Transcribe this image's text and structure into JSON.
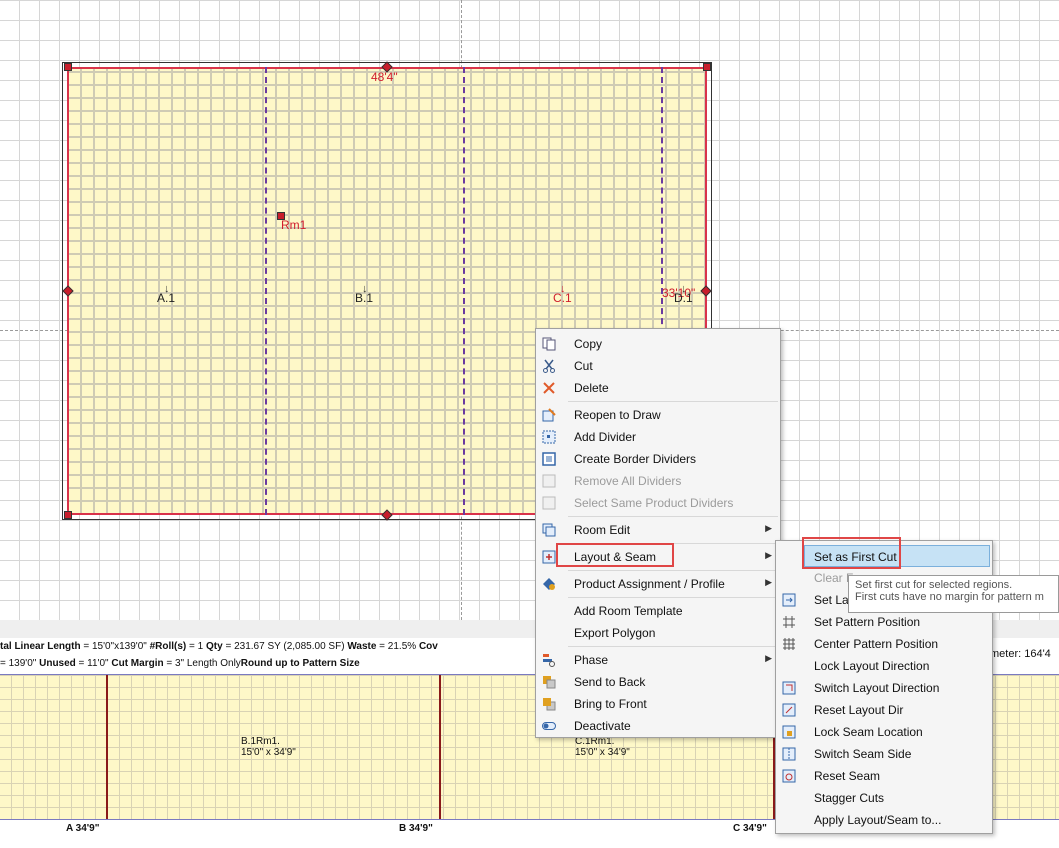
{
  "room": {
    "name": "Rm1",
    "top_dimension": "48'4\"",
    "right_dimension": "33'10\"",
    "regions": [
      {
        "label": "A.1",
        "color": "#222222"
      },
      {
        "label": "B.1",
        "color": "#222222"
      },
      {
        "label": "C.1",
        "color": "#d01c2c"
      },
      {
        "label": "D.1",
        "color": "#222222"
      }
    ]
  },
  "status": {
    "line1_prefix": "tal Linear Length",
    "line1_value": " = 15'0\"x139'0\"  ",
    "rolls_label": "#Roll(s)",
    "rolls_value": " = 1  ",
    "qty_label": "Qty",
    "qty_value": " = 231.67 SY (2,085.00 SF)  ",
    "waste_label": "Waste",
    "waste_value": " = 21.5%  ",
    "cov_label": "Cov",
    "line2_prefix": " = 139'0\"  ",
    "unused_label": "Unused",
    "unused_value": " = 11'0\" ",
    "cut_margin_label": "Cut Margin",
    "cut_margin_value": " = 3\" Length Only",
    "round_label": "Round up to Pattern Size",
    "perimeter_fragment": "meter: 164'4"
  },
  "strip": {
    "pieces": [
      {
        "name": "B.1Rm1.",
        "size": "15'0\" x 34'9\""
      },
      {
        "name": "C.1Rm1.",
        "size": "15'0\" x 34'9\""
      }
    ],
    "axis_labels": [
      "A 34'9\"",
      "B 34'9\"",
      "C 34'9\""
    ]
  },
  "context_menu": {
    "items": [
      {
        "label": "Copy",
        "icon": "copy-icon",
        "disabled": false
      },
      {
        "label": "Cut",
        "icon": "scissors-icon",
        "disabled": false
      },
      {
        "label": "Delete",
        "icon": "delete-x-icon",
        "disabled": false
      },
      {
        "label": "Reopen to Draw",
        "icon": "reopen-draw-icon",
        "disabled": false
      },
      {
        "label": "Add Divider",
        "icon": "add-divider-icon",
        "disabled": false
      },
      {
        "label": "Create Border Dividers",
        "icon": "border-dividers-icon",
        "disabled": false
      },
      {
        "label": "Remove All Dividers",
        "icon": "remove-dividers-icon",
        "disabled": true
      },
      {
        "label": "Select Same Product Dividers",
        "icon": "select-dividers-icon",
        "disabled": true
      },
      {
        "label": "Room Edit",
        "icon": "room-edit-icon",
        "disabled": false,
        "submenu": true
      },
      {
        "label": "Layout & Seam",
        "icon": "layout-seam-icon",
        "disabled": false,
        "submenu": true
      },
      {
        "label": "Product Assignment / Profile",
        "icon": "product-assignment-icon",
        "disabled": false,
        "submenu": true
      },
      {
        "label": "Add Room Template",
        "icon": "",
        "disabled": false
      },
      {
        "label": "Export Polygon",
        "icon": "",
        "disabled": false
      },
      {
        "label": "Phase",
        "icon": "phase-icon",
        "disabled": false,
        "submenu": true
      },
      {
        "label": "Send to Back",
        "icon": "send-to-back-icon",
        "disabled": false
      },
      {
        "label": "Bring to Front",
        "icon": "bring-to-front-icon",
        "disabled": false
      },
      {
        "label": "Deactivate",
        "icon": "toggle-icon",
        "disabled": false
      }
    ]
  },
  "submenu": {
    "items": [
      {
        "label": "Set as First Cut",
        "icon": "",
        "highlighted": true
      },
      {
        "label": "Clear F",
        "icon": "",
        "disabled": true
      },
      {
        "label": "Set Lay",
        "icon": "set-layout-icon"
      },
      {
        "label": "Set Pattern Position",
        "icon": "pattern-position-icon"
      },
      {
        "label": "Center Pattern Position",
        "icon": "center-pattern-icon"
      },
      {
        "label": "Lock Layout Direction",
        "icon": ""
      },
      {
        "label": "Switch Layout Direction",
        "icon": "switch-layout-icon"
      },
      {
        "label": "Reset Layout Dir",
        "icon": "reset-layout-icon"
      },
      {
        "label": "Lock Seam Location",
        "icon": "lock-seam-icon"
      },
      {
        "label": "Switch Seam Side",
        "icon": "switch-seam-icon"
      },
      {
        "label": "Reset Seam",
        "icon": "reset-seam-icon"
      },
      {
        "label": "Stagger Cuts",
        "icon": ""
      },
      {
        "label": "Apply Layout/Seam to...",
        "icon": ""
      }
    ]
  },
  "tooltip": {
    "line1": "Set first cut for selected regions.",
    "line2": "First cuts have no margin for pattern m"
  },
  "colors": {
    "seam": "#6a3aa0",
    "room_border": "#d9334a",
    "highlight": "#c6e2f5",
    "callout": "#e04646"
  }
}
